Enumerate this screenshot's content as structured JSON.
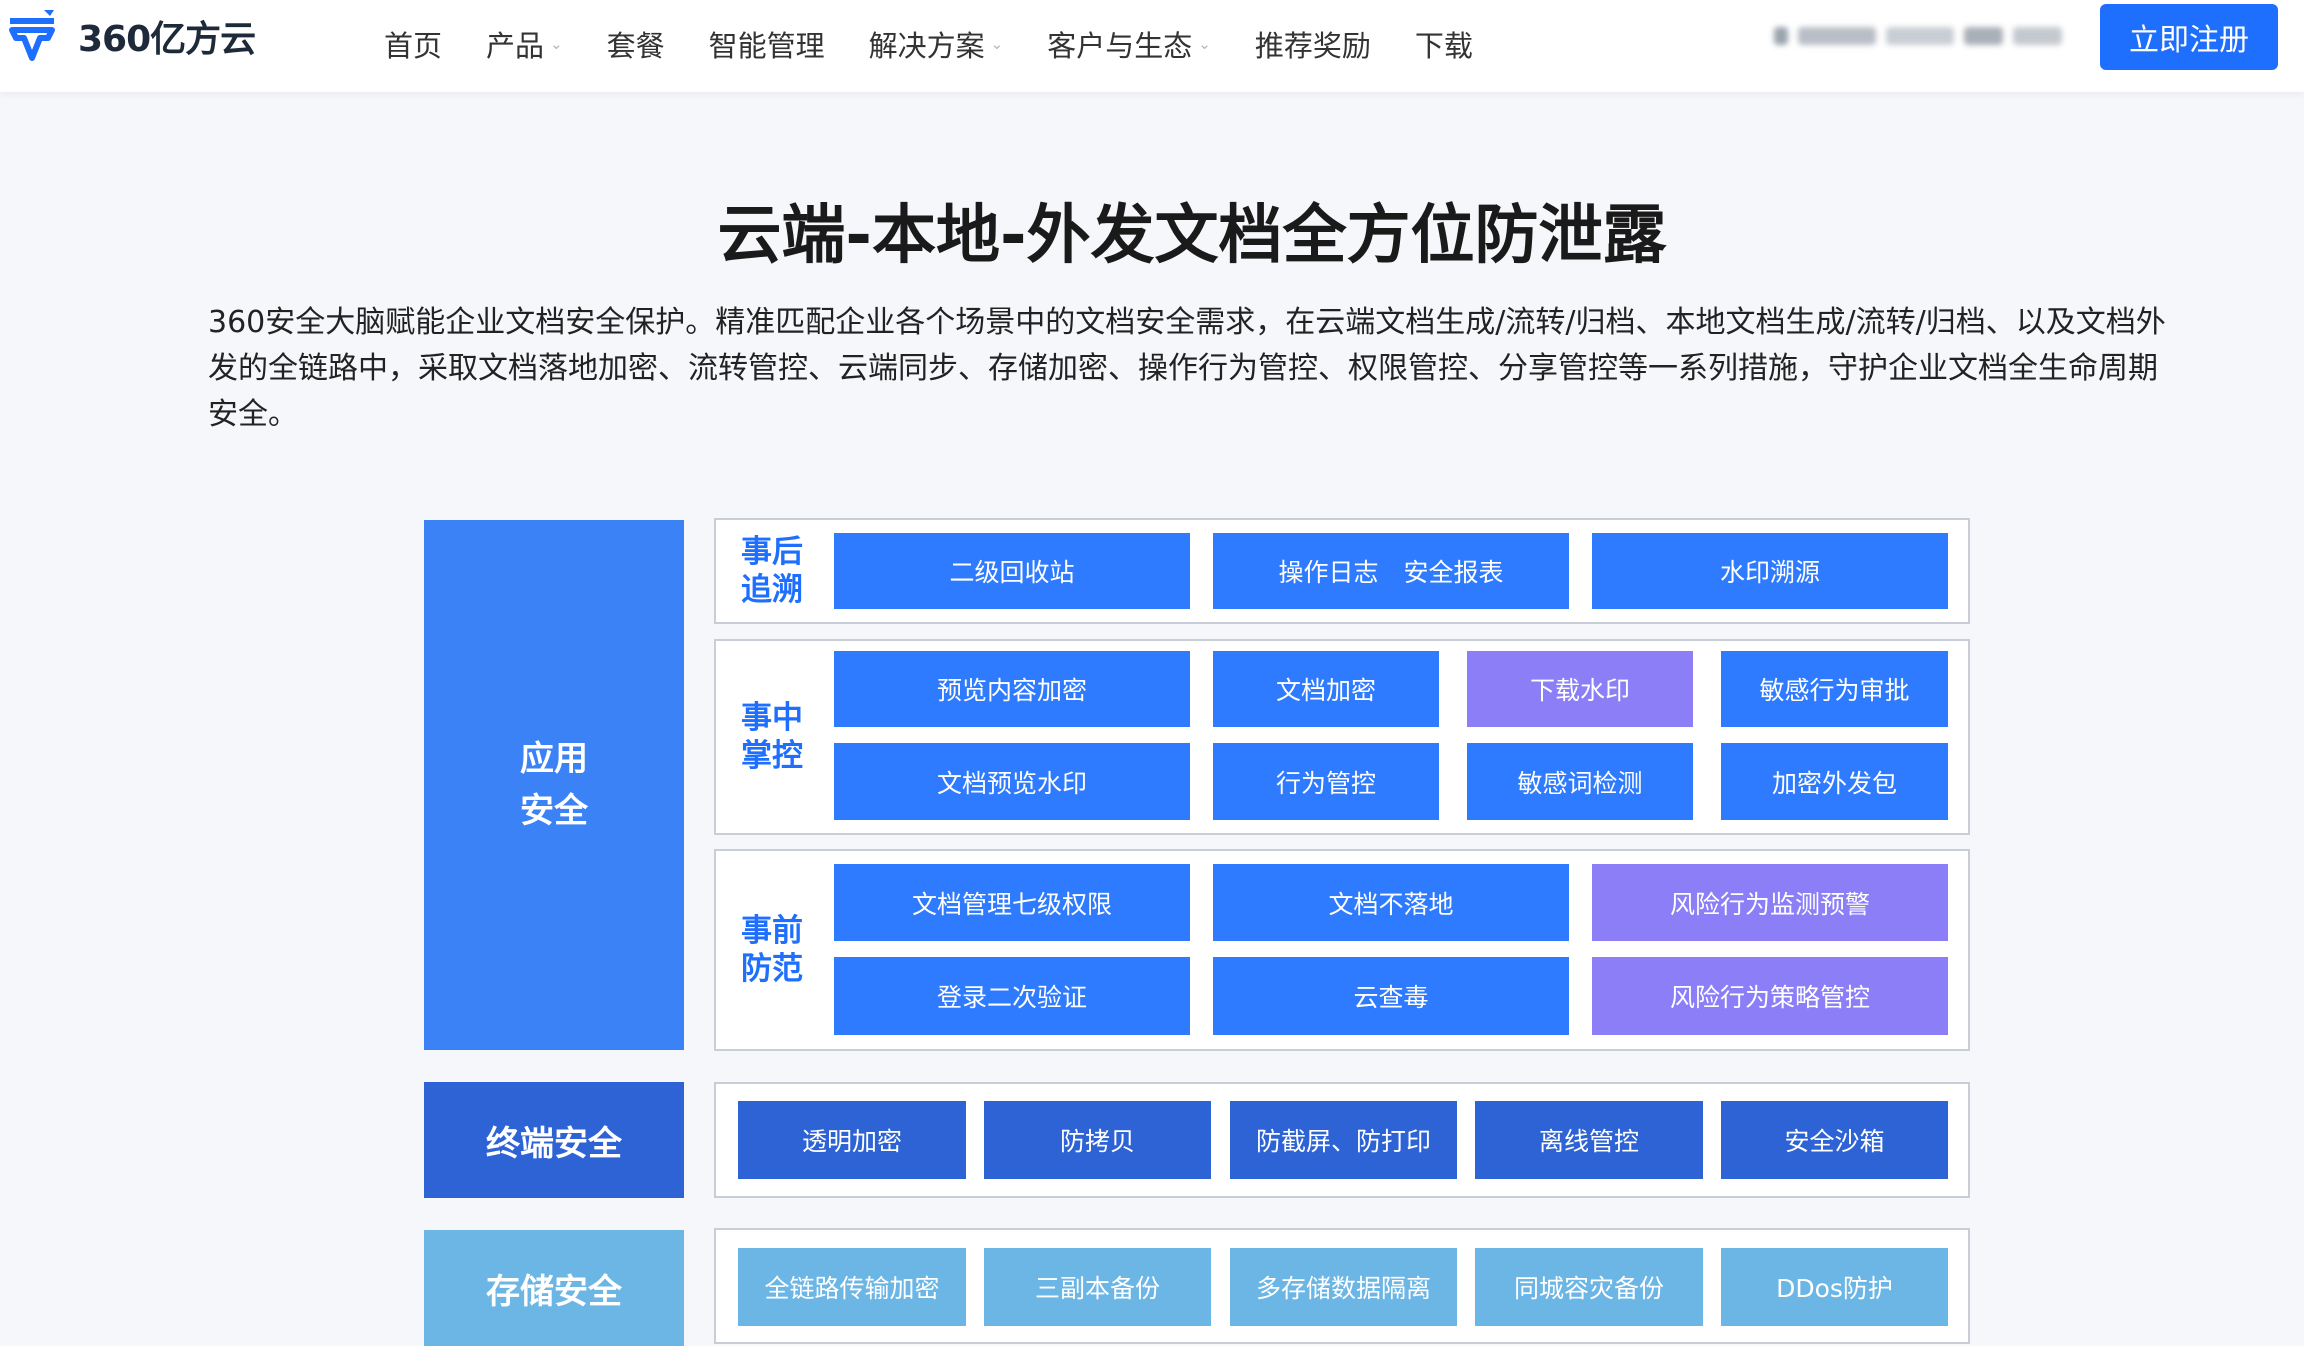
{
  "brand": {
    "name": "360亿方云",
    "primary_color": "#1f6fff",
    "logo_icon": "cloud-shield-logo-icon"
  },
  "nav": [
    {
      "label": "首页",
      "has_dropdown": false
    },
    {
      "label": "产品",
      "has_dropdown": true
    },
    {
      "label": "套餐",
      "has_dropdown": false
    },
    {
      "label": "智能管理",
      "has_dropdown": false
    },
    {
      "label": "解决方案",
      "has_dropdown": true
    },
    {
      "label": "客户与生态",
      "has_dropdown": true
    },
    {
      "label": "推荐奖励",
      "has_dropdown": false
    },
    {
      "label": "下载",
      "has_dropdown": false
    }
  ],
  "header_actions": {
    "register_label": "立即注册"
  },
  "hero": {
    "title": "云端-本地-外发文档全方位防泄露",
    "description": "360安全大脑赋能企业文档安全保护。精准匹配企业各个场景中的文档安全需求，在云端文档生成/流转/归档、本地文档生成/流转/归档、以及文档外发的全链路中，采取文档落地加密、流转管控、云端同步、存储加密、操作行为管控、权限管控、分享管控等一系列措施，守护企业文档全生命周期安全。"
  },
  "diagram": {
    "colors": {
      "blue": "#2f7bff",
      "purple": "#8b7ef7",
      "dark_blue": "#2d63d4",
      "light_blue": "#6cb6e6",
      "side_label": "#1f6fff"
    },
    "app_security": {
      "label_line1": "应用",
      "label_line2": "安全",
      "post": {
        "label_line1": "事后",
        "label_line2": "追溯",
        "items": [
          "二级回收站",
          "操作日志　安全报表",
          "水印溯源"
        ]
      },
      "during": {
        "label_line1": "事中",
        "label_line2": "掌控",
        "items": [
          "预览内容加密",
          "文档加密",
          "下载水印",
          "敏感行为审批",
          "文档预览水印",
          "行为管控",
          "敏感词检测",
          "加密外发包"
        ]
      },
      "pre": {
        "label_line1": "事前",
        "label_line2": "防范",
        "items": [
          "文档管理七级权限",
          "文档不落地",
          "风险行为监测预警",
          "登录二次验证",
          "云查毒",
          "风险行为策略管控"
        ]
      }
    },
    "terminal_security": {
      "label": "终端安全",
      "items": [
        "透明加密",
        "防拷贝",
        "防截屏、防打印",
        "离线管控",
        "安全沙箱"
      ]
    },
    "storage_security": {
      "label": "存储安全",
      "items": [
        "全链路传输加密",
        "三副本备份",
        "多存储数据隔离",
        "同城容灾备份",
        "DDos防护"
      ]
    }
  }
}
